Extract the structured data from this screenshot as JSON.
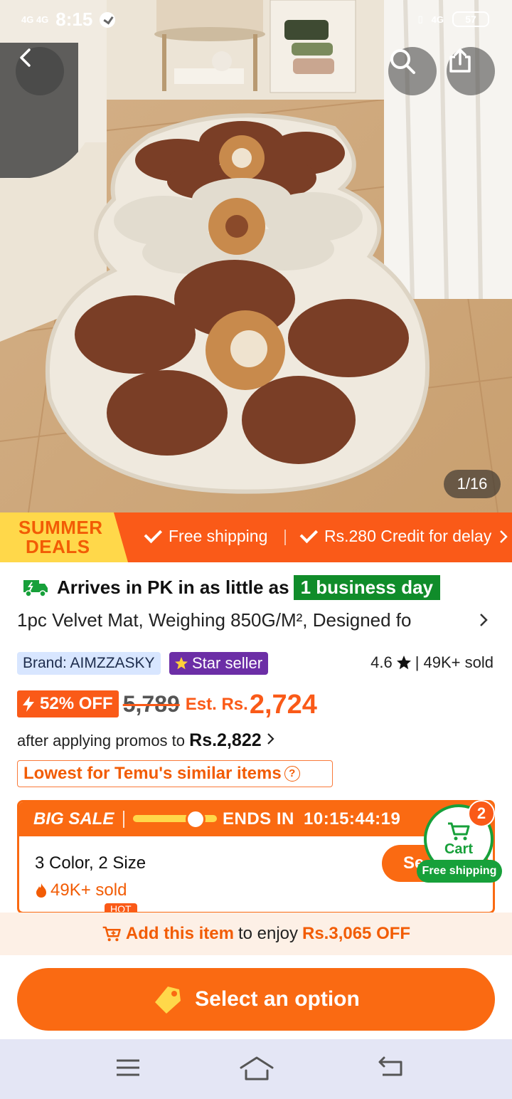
{
  "status_bar": {
    "signal_left": "4G 4G",
    "time": "8:15",
    "signal_right": "4G",
    "battery": "57"
  },
  "hero": {
    "image_counter": "1/16"
  },
  "promo_banner": {
    "deal_line1": "SUMMER",
    "deal_line2": "DEALS",
    "perk1": "Free shipping",
    "perk2": "Rs.280 Credit for delay"
  },
  "delivery": {
    "prefix": "Arrives in PK in as little as",
    "highlight": "1 business day"
  },
  "product": {
    "title": "1pc Velvet Mat, Weighing 850G/M², Designed fo",
    "brand": "Brand: AIMZZASKY",
    "star_seller": "Star seller",
    "rating": "4.6",
    "sold": "| 49K+ sold",
    "discount": "52% OFF",
    "original_price": "5,789",
    "est_label": "Est. Rs.",
    "price": "2,724",
    "after_promo_text": "after applying promos to",
    "after_promo_price": "Rs.2,822",
    "lowest_label": "Lowest for Temu's similar items"
  },
  "big_sale": {
    "label": "BIG SALE",
    "ends_label": "ENDS IN",
    "countdown": "10:15:44:19",
    "variants": "3 Color, 2 Size",
    "sold": "49K+ sold",
    "select_button": "Se",
    "hot_badge": "HOT"
  },
  "cart": {
    "count": "2",
    "label": "Cart",
    "shipping": "Free shipping"
  },
  "add_bar": {
    "action": "Add this item",
    "middle": "to enjoy",
    "savings": "Rs.3,065 OFF"
  },
  "cta": {
    "label": "Select an option"
  },
  "colors": {
    "accent": "#fa6a12",
    "green": "#17a03a",
    "star_seller_bg": "#6c2ea6"
  }
}
